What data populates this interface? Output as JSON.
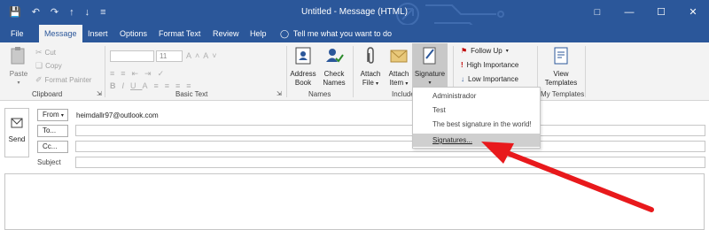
{
  "window": {
    "title": "Untitled  -  Message (HTML)"
  },
  "tabs": [
    "File",
    "Message",
    "Insert",
    "Options",
    "Format Text",
    "Review",
    "Help"
  ],
  "tell_me": "Tell me what you want to do",
  "clipboard": {
    "paste": "Paste",
    "cut": "Cut",
    "copy": "Copy",
    "format_painter": "Format Painter",
    "label": "Clipboard"
  },
  "basic_text": {
    "font_size": "11",
    "label": "Basic Text"
  },
  "names": {
    "address_book": [
      "Address",
      "Book"
    ],
    "check_names": [
      "Check",
      "Names"
    ],
    "label": "Names"
  },
  "include": {
    "attach_file": [
      "Attach",
      "File"
    ],
    "attach_item": [
      "Attach",
      "Item"
    ],
    "signature": "Signature",
    "label": "Include"
  },
  "tags": {
    "follow_up": "Follow Up",
    "high_importance": "High Importance",
    "low_importance": "Low Importance"
  },
  "templates": {
    "view_templates": [
      "View",
      "Templates"
    ],
    "label": "My Templates"
  },
  "header": {
    "send": "Send",
    "from_label": "From",
    "from_value": "heimdallr97@outlook.com",
    "to_label": "To...",
    "cc_label": "Cc...",
    "subject_label": "Subject"
  },
  "signature_menu": {
    "items": [
      "Administrador",
      "Test",
      "The best signature in the world!"
    ],
    "manage": "Signatures..."
  },
  "colors": {
    "accent": "#2b579a",
    "arrow": "#e8191c"
  }
}
